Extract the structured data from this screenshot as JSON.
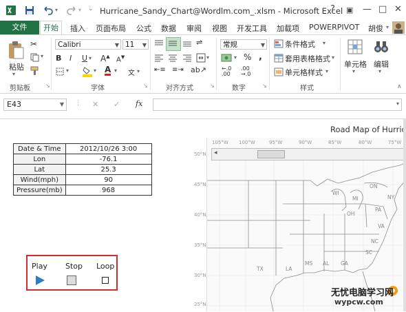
{
  "window": {
    "title": "Hurricane_Sandy_Chart@Wordlm.com_.xlsm - Microsoft Excel",
    "help": "?",
    "restore": "▣",
    "minimize": "—",
    "maximize": "□",
    "close": "✕"
  },
  "tabs": {
    "file": "文件",
    "home": "开始",
    "insert": "插入",
    "page_layout": "页面布局",
    "formulas": "公式",
    "data": "数据",
    "review": "审阅",
    "view": "视图",
    "developer": "开发工具",
    "addins": "加载项",
    "powerpivot": "POWERPIVOT",
    "user": "胡俊"
  },
  "ribbon": {
    "paste": "粘贴",
    "font_name": "Calibri",
    "font_size": "11",
    "number_format": "常规",
    "conditional_format": "条件格式",
    "table_format": "套用表格格式",
    "cell_styles": "单元格样式",
    "cells": "单元格",
    "edit": "编辑",
    "bold": "B",
    "italic": "I",
    "underline": "U",
    "font_color_glyph": "A",
    "percent": "%",
    "comma": ",",
    "groups": {
      "clipboard": "剪贴板",
      "font": "字体",
      "alignment": "对齐方式",
      "number": "数字",
      "styles": "样式"
    }
  },
  "formula_bar": {
    "name_box": "E43",
    "fx": "fx",
    "cancel": "✕",
    "enter": "✓",
    "value": ""
  },
  "table": [
    {
      "key": "Date & Time",
      "value": "2012/10/26 3:00"
    },
    {
      "key": "Lon",
      "value": "-76.1"
    },
    {
      "key": "Lat",
      "value": "25.3"
    },
    {
      "key": "Wind(mph)",
      "value": "90"
    },
    {
      "key": "Pressure(mb)",
      "value": "968"
    }
  ],
  "controls": {
    "play": "Play",
    "stop": "Stop",
    "loop": "Loop"
  },
  "map": {
    "title": "Road Map of Hurric",
    "lon_labels": [
      "105°W",
      "100°W",
      "95°W",
      "90°W",
      "85°W",
      "80°W",
      "75°W"
    ],
    "lat_labels": [
      "50°N",
      "45°N",
      "40°N",
      "35°N",
      "30°N",
      "25°N"
    ],
    "states": [
      "ON",
      "WI",
      "MI",
      "PA",
      "OH",
      "NY",
      "VA",
      "NC",
      "SC",
      "TX",
      "LA",
      "MS",
      "AL",
      "GA"
    ]
  },
  "watermark": {
    "line1": "无忧电脑学习网",
    "line2": "wypcw.com"
  }
}
